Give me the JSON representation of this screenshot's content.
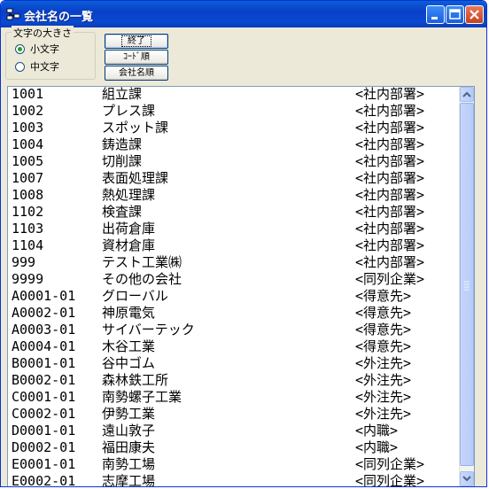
{
  "window": {
    "title": "会社名の一覧"
  },
  "group": {
    "label": "文字の大きさ",
    "options": [
      {
        "label": "小文字",
        "selected": true
      },
      {
        "label": "中文字",
        "selected": false
      }
    ]
  },
  "buttons": {
    "exit": "終了",
    "code_order": "ｺｰﾄﾞ順",
    "name_order": "会社名順"
  },
  "list": {
    "rows": [
      {
        "code": "1001",
        "name": "組立課",
        "type": "<社内部署>"
      },
      {
        "code": "1002",
        "name": "プレス課",
        "type": "<社内部署>"
      },
      {
        "code": "1003",
        "name": "スポット課",
        "type": "<社内部署>"
      },
      {
        "code": "1004",
        "name": "鋳造課",
        "type": "<社内部署>"
      },
      {
        "code": "1005",
        "name": "切削課",
        "type": "<社内部署>"
      },
      {
        "code": "1007",
        "name": "表面処理課",
        "type": "<社内部署>"
      },
      {
        "code": "1008",
        "name": "熱処理課",
        "type": "<社内部署>"
      },
      {
        "code": "1102",
        "name": "検査課",
        "type": "<社内部署>"
      },
      {
        "code": "1103",
        "name": "出荷倉庫",
        "type": "<社内部署>"
      },
      {
        "code": "1104",
        "name": "資材倉庫",
        "type": "<社内部署>"
      },
      {
        "code": "999",
        "name": "テスト工業㈱",
        "type": "<社内部署>"
      },
      {
        "code": "9999",
        "name": "その他の会社",
        "type": "<同列企業>"
      },
      {
        "code": "A0001-01",
        "name": "グローバル",
        "type": "<得意先>"
      },
      {
        "code": "A0002-01",
        "name": "神原電気",
        "type": "<得意先>"
      },
      {
        "code": "A0003-01",
        "name": "サイバーテック",
        "type": "<得意先>"
      },
      {
        "code": "A0004-01",
        "name": "木谷工業",
        "type": "<得意先>"
      },
      {
        "code": "B0001-01",
        "name": "谷中ゴム",
        "type": "<外注先>"
      },
      {
        "code": "B0002-01",
        "name": "森林鉄工所",
        "type": "<外注先>"
      },
      {
        "code": "C0001-01",
        "name": "南勢螺子工業",
        "type": "<外注先>"
      },
      {
        "code": "C0002-01",
        "name": "伊勢工業",
        "type": "<外注先>"
      },
      {
        "code": "D0001-01",
        "name": "遠山敦子",
        "type": "<内職>"
      },
      {
        "code": "D0002-01",
        "name": "福田康夫",
        "type": "<内職>"
      },
      {
        "code": "E0001-01",
        "name": "南勢工場",
        "type": "<同列企業>"
      },
      {
        "code": "E0002-01",
        "name": "志摩工場",
        "type": "<同列企業>"
      }
    ]
  },
  "colors": {
    "titlebar": "#0a49d0",
    "radio_dot": "#21a121",
    "list_border": "#7f9db9"
  }
}
